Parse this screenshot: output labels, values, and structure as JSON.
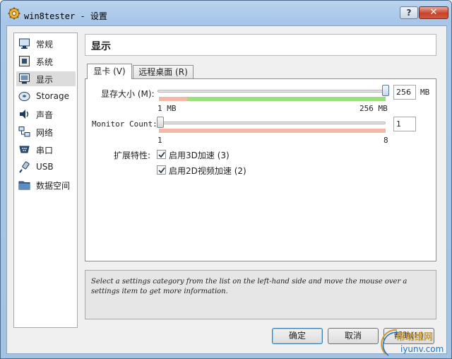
{
  "window": {
    "title": "win8tester - ",
    "title_zh": "设置",
    "help_label": "?",
    "close_label": "✕"
  },
  "sidebar": {
    "items": [
      {
        "label": "常规",
        "icon": "monitor-icon"
      },
      {
        "label": "系统",
        "icon": "chip-icon"
      },
      {
        "label": "显示",
        "icon": "display-icon",
        "selected": true
      },
      {
        "label": "Storage",
        "icon": "disk-icon"
      },
      {
        "label": "声音",
        "icon": "speaker-icon"
      },
      {
        "label": "网络",
        "icon": "network-icon"
      },
      {
        "label": "串口",
        "icon": "serial-port-icon"
      },
      {
        "label": "USB",
        "icon": "usb-icon"
      },
      {
        "label": "数据空间",
        "icon": "folder-icon"
      }
    ]
  },
  "header": {
    "title": "显示"
  },
  "tabs": [
    {
      "label": "显卡 (V)",
      "active": true
    },
    {
      "label": "远程桌面 (R)",
      "active": false
    }
  ],
  "video": {
    "memory_label": "显存大小 (M):",
    "memory_value": "256",
    "memory_unit": "MB",
    "memory_min_label": "1  MB",
    "memory_max_label": "256  MB",
    "memory_fraction": 1.0,
    "monitor_label": "Monitor Count:",
    "monitor_value": "1",
    "monitor_min_label": "1",
    "monitor_max_label": "8",
    "monitor_fraction": 0.0,
    "extended_label": "扩展特性:",
    "enable_3d_label": "启用3D加速 (3)",
    "enable_3d_checked": true,
    "enable_2d_label": "启用2D视频加速 (2)",
    "enable_2d_checked": true
  },
  "info": {
    "text": "Select a settings category from the list on the left-hand side and move the mouse over a settings item to get more information."
  },
  "buttons": {
    "ok": "确定",
    "cancel": "取消",
    "help": "帮助(H)"
  },
  "watermark": {
    "top": "帮助维网",
    "bottom": "iyunv.com"
  },
  "colors": {
    "accent": "#3c7fb1",
    "green_zone": "#9be07c",
    "red_zone": "#f3b8a6",
    "selected_item": "#dcdcdc"
  }
}
